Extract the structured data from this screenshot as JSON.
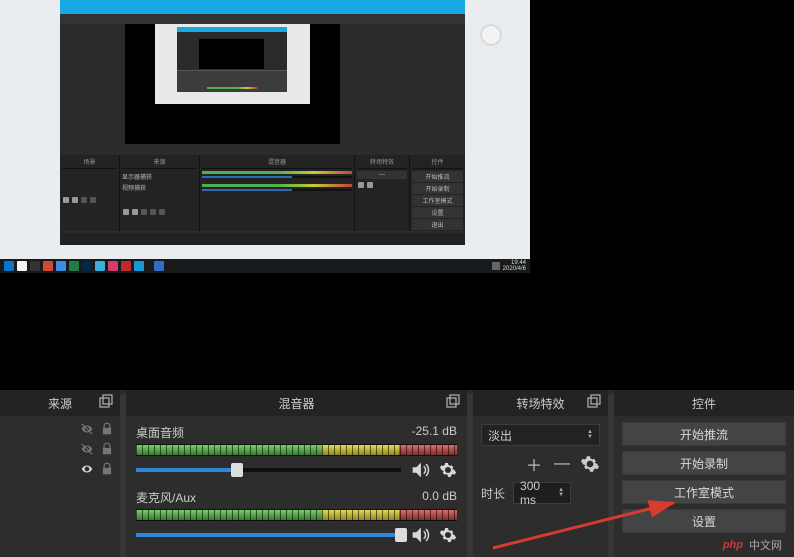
{
  "preview": {
    "clock_time": "19:44",
    "clock_date": "2020/4/6"
  },
  "inner_obs": {
    "panels": {
      "scenes": "场景",
      "sources": "来源",
      "mixer": "混音器",
      "transitions": "转场特效",
      "controls": "控件"
    },
    "sources": {
      "item1": "显示器捕获",
      "item2": "视频捕获"
    },
    "controls": {
      "start_stream": "开始推流",
      "start_record": "开始录制",
      "studio": "工作室模式",
      "settings": "设置",
      "exit": "退出"
    }
  },
  "sources_panel": {
    "title": "来源"
  },
  "mixer": {
    "title": "混音器",
    "ch1": {
      "name": "桌面音频",
      "db": "-25.1 dB",
      "fill_pct": 38
    },
    "ch2": {
      "name": "麦克风/Aux",
      "db": "0.0 dB",
      "fill_pct": 100
    }
  },
  "transitions": {
    "title": "转场特效",
    "selected": "淡出",
    "duration_label": "时长",
    "duration_value": "300 ms"
  },
  "controls": {
    "title": "控件",
    "start_stream": "开始推流",
    "start_record": "开始录制",
    "studio": "工作室模式",
    "settings": "设置"
  },
  "watermark": {
    "brand": "php",
    "site": "中文网"
  }
}
